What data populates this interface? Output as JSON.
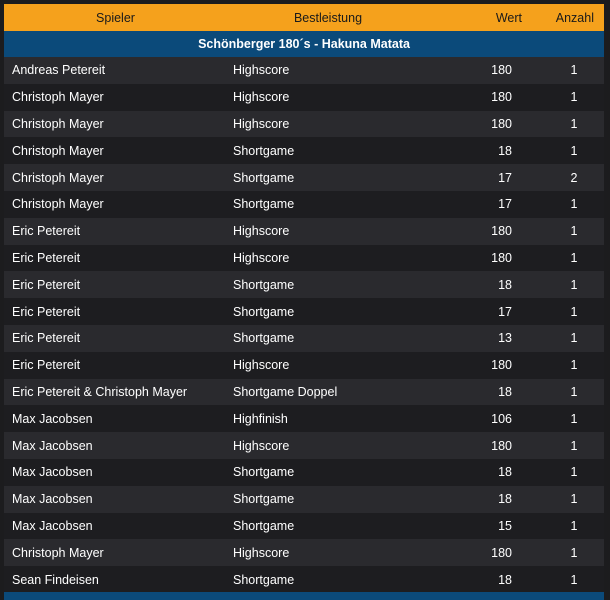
{
  "columns": {
    "player": "Spieler",
    "performance": "Bestleistung",
    "value": "Wert",
    "count": "Anzahl"
  },
  "group": {
    "title": "Schönberger 180´s - Hakuna Matata"
  },
  "rows": [
    {
      "player": "Andreas Petereit",
      "performance": "Highscore",
      "value": "180",
      "count": "1"
    },
    {
      "player": "Christoph Mayer",
      "performance": "Highscore",
      "value": "180",
      "count": "1"
    },
    {
      "player": "Christoph Mayer",
      "performance": "Highscore",
      "value": "180",
      "count": "1"
    },
    {
      "player": "Christoph Mayer",
      "performance": "Shortgame",
      "value": "18",
      "count": "1"
    },
    {
      "player": "Christoph Mayer",
      "performance": "Shortgame",
      "value": "17",
      "count": "2"
    },
    {
      "player": "Christoph Mayer",
      "performance": "Shortgame",
      "value": "17",
      "count": "1"
    },
    {
      "player": "Eric Petereit",
      "performance": "Highscore",
      "value": "180",
      "count": "1"
    },
    {
      "player": "Eric Petereit",
      "performance": "Highscore",
      "value": "180",
      "count": "1"
    },
    {
      "player": "Eric Petereit",
      "performance": "Shortgame",
      "value": "18",
      "count": "1"
    },
    {
      "player": "Eric Petereit",
      "performance": "Shortgame",
      "value": "17",
      "count": "1"
    },
    {
      "player": "Eric Petereit",
      "performance": "Shortgame",
      "value": "13",
      "count": "1"
    },
    {
      "player": "Eric Petereit",
      "performance": "Highscore",
      "value": "180",
      "count": "1"
    },
    {
      "player": "Eric Petereit & Christoph Mayer",
      "performance": "Shortgame Doppel",
      "value": "18",
      "count": "1"
    },
    {
      "player": "Max Jacobsen",
      "performance": "Highfinish",
      "value": "106",
      "count": "1"
    },
    {
      "player": "Max Jacobsen",
      "performance": "Highscore",
      "value": "180",
      "count": "1"
    },
    {
      "player": "Max Jacobsen",
      "performance": "Shortgame",
      "value": "18",
      "count": "1"
    },
    {
      "player": "Max Jacobsen",
      "performance": "Shortgame",
      "value": "18",
      "count": "1"
    },
    {
      "player": "Max Jacobsen",
      "performance": "Shortgame",
      "value": "15",
      "count": "1"
    },
    {
      "player": "Christoph Mayer",
      "performance": "Highscore",
      "value": "180",
      "count": "1"
    },
    {
      "player": "Sean Findeisen",
      "performance": "Shortgame",
      "value": "18",
      "count": "1"
    }
  ],
  "colors": {
    "header_bg": "#f5a11c",
    "group_bg": "#0b4a7a",
    "row_even": "#2a2a2e",
    "row_odd": "#1d1d20",
    "text": "#ffffff"
  }
}
